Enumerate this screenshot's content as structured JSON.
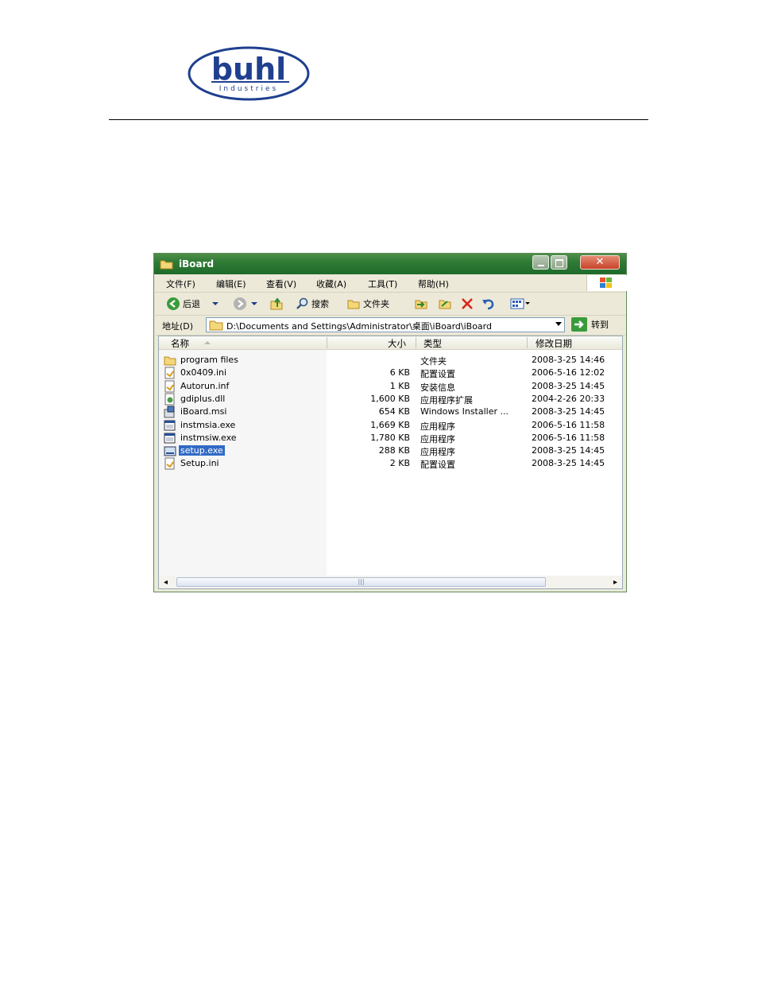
{
  "doc": {
    "logo_text": "buhl",
    "logo_subtext": "Industries"
  },
  "window": {
    "title": "iBoard",
    "close_glyph": "✕"
  },
  "menu": [
    "文件(F)",
    "编辑(E)",
    "查看(V)",
    "收藏(A)",
    "工具(T)",
    "帮助(H)"
  ],
  "toolbar": {
    "back_label": "后退",
    "search_label": "搜索",
    "folders_label": "文件夹"
  },
  "address": {
    "label": "地址(D)",
    "path": "D:\\Documents and Settings\\Administrator\\桌面\\iBoard\\iBoard",
    "go_label": "转到"
  },
  "columns": {
    "name": "名称",
    "size": "大小",
    "type": "类型",
    "modified": "修改日期"
  },
  "files": [
    {
      "name": "program files",
      "size": "",
      "type": "文件夹",
      "modified": "2008-3-25 14:46",
      "icon": "folder-icon"
    },
    {
      "name": "0x0409.ini",
      "size": "6 KB",
      "type": "配置设置",
      "modified": "2006-5-16 12:02",
      "icon": "ini-file-icon"
    },
    {
      "name": "Autorun.inf",
      "size": "1 KB",
      "type": "安装信息",
      "modified": "2008-3-25 14:45",
      "icon": "inf-file-icon"
    },
    {
      "name": "gdiplus.dll",
      "size": "1,600 KB",
      "type": "应用程序扩展",
      "modified": "2004-2-26 20:33",
      "icon": "dll-file-icon"
    },
    {
      "name": "iBoard.msi",
      "size": "654 KB",
      "type": "Windows Installer ...",
      "modified": "2008-3-25 14:45",
      "icon": "msi-file-icon"
    },
    {
      "name": "instmsia.exe",
      "size": "1,669 KB",
      "type": "应用程序",
      "modified": "2006-5-16 11:58",
      "icon": "exe-file-icon"
    },
    {
      "name": "instmsiw.exe",
      "size": "1,780 KB",
      "type": "应用程序",
      "modified": "2006-5-16 11:58",
      "icon": "exe-file-icon"
    },
    {
      "name": "setup.exe",
      "size": "288 KB",
      "type": "应用程序",
      "modified": "2008-3-25 14:45",
      "icon": "setup-exe-icon",
      "selected": true
    },
    {
      "name": "Setup.ini",
      "size": "2 KB",
      "type": "配置设置",
      "modified": "2008-3-25 14:45",
      "icon": "ini-file-icon"
    }
  ],
  "colors": {
    "title_green": "#2f7b35",
    "selection": "#316ac5",
    "logo_blue": "#1f3f8f"
  }
}
